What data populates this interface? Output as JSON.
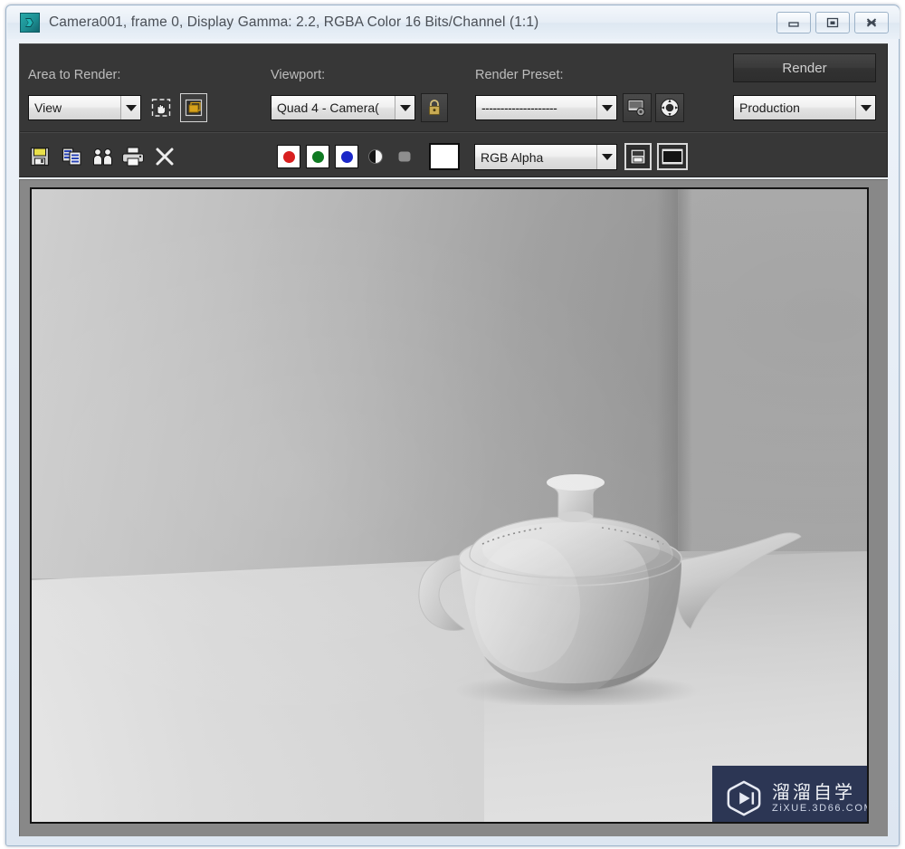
{
  "window": {
    "title": "Camera001, frame 0, Display Gamma: 2.2, RGBA Color 16 Bits/Channel (1:1)",
    "app_icon": "3dsmax-icon",
    "controls": {
      "minimize": "minimize-icon",
      "maximize": "maximize-icon",
      "close": "close-icon"
    }
  },
  "toolbar": {
    "area_to_render": {
      "label": "Area to Render:",
      "value": "View",
      "pan_icon": "hand-pan-icon",
      "region_icon": "auto-region-selected-icon"
    },
    "viewport": {
      "label": "Viewport:",
      "value": "Quad 4 - Camera(",
      "lock_icon": "lock-icon"
    },
    "render_preset": {
      "label": "Render Preset:",
      "value": "--------------------",
      "setup_icon": "render-setup-icon",
      "env_icon": "environment-icon"
    },
    "render_button": "Render",
    "render_mode": "Production"
  },
  "toolbar2": {
    "save_icon": "save-image-icon",
    "copy_icon": "copy-image-icon",
    "clone_icon": "clone-rendered-frame-icon",
    "print_icon": "print-image-icon",
    "clear_icon": "clear-image-icon",
    "red_channel": "red-channel-icon",
    "green_channel": "green-channel-icon",
    "blue_channel": "blue-channel-icon",
    "mono_channel": "monochrome-icon",
    "alpha_channel": "alpha-channel-icon",
    "color_swatch": "background-color-swatch",
    "channel_select": "RGB Alpha",
    "toggle_ui_icon": "toggle-ui-overlay-icon",
    "duplicate_icon": "duplicate-view-icon",
    "colors": {
      "red": "#d81f1f",
      "green": "#0f7a22",
      "blue": "#1a27c8",
      "swatch": "#ffffff"
    }
  },
  "render_image": {
    "scene": "3d-teapot-in-corner-room",
    "description": "Grayscale rendered Utah teapot resting on a floor against two walls"
  },
  "watermark": {
    "logo_icon": "play-button-logo-icon",
    "title_cn": "溜溜自学",
    "url": "ZiXUE.3D66.COM",
    "bg_color": "#2c3654"
  }
}
